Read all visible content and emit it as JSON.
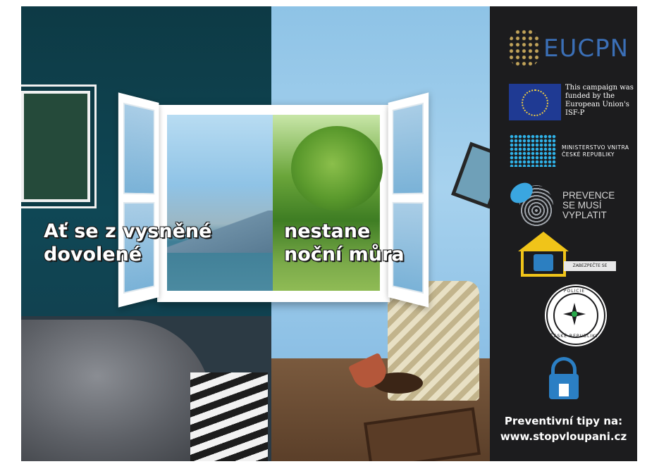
{
  "headline": {
    "left_line1": "Ať se z vysněné",
    "left_line2": "dovolené",
    "right_line1": "nestane",
    "right_line2": "noční můra"
  },
  "sidebar": {
    "eucpn_logo": "EUCPN",
    "eu_funding_text": "This campaign was funded by the European Union's ISF-P",
    "ministry_line1": "MINISTERSTVO VNITRA",
    "ministry_line2": "ČESKÉ REPUBLIKY",
    "prevence_line1": "PREVENCE",
    "prevence_line2": "SE MUSÍ VYPLATIT",
    "zabezpecte_sign": "ZABEZPEČTE SE",
    "police_seal_top": "POLICIE",
    "police_seal_bottom": "ČESKÉ REPUBLIKY",
    "cta_line1": "Preventivní tipy na:",
    "cta_line2": "www.stopvloupani.cz"
  },
  "colors": {
    "sidebar_bg": "#1c1c1e",
    "left_wall": "#0f4755",
    "right_wall": "#a7d2ee",
    "eucpn_blue": "#3b6fb6",
    "eu_flag": "#1f3a93",
    "ministry_cyan": "#2fb2e8",
    "yellow": "#f0c419"
  },
  "icons": [
    "eucpn-logo-icon",
    "eu-flag-icon",
    "ministry-logo-icon",
    "butterfly-fingerprint-icon",
    "house-lock-icon",
    "police-seal-icon",
    "padlock-house-icon"
  ]
}
